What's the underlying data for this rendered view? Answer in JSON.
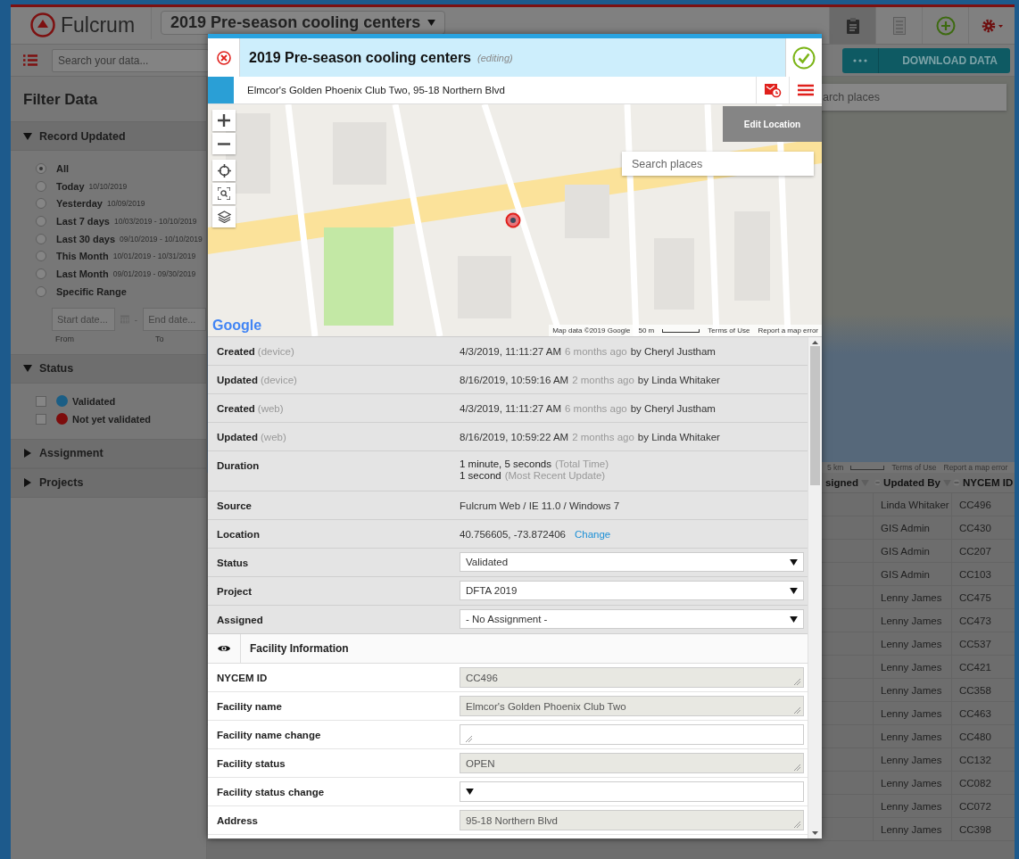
{
  "header": {
    "logo": "Fulcrum",
    "app_title": "2019 Pre-season cooling centers",
    "nav_tabs": [
      {
        "kind": "clipboard",
        "selected": true
      },
      {
        "kind": "list",
        "selected": false
      },
      {
        "kind": "add",
        "selected": false
      },
      {
        "kind": "settings",
        "selected": false
      }
    ]
  },
  "toolbar": {
    "search_placeholder": "Search your data...",
    "download_label": "DOWNLOAD DATA"
  },
  "sidebar": {
    "title": "Filter Data",
    "sections": [
      {
        "kind": "radios",
        "title": "Record Updated",
        "expanded": true,
        "options": [
          {
            "label": "All",
            "selected": true
          },
          {
            "label": "Today",
            "range": "10/10/2019",
            "selected": false
          },
          {
            "label": "Yesterday",
            "range": "10/09/2019",
            "selected": false
          },
          {
            "label": "Last 7 days",
            "range": "10/03/2019 - 10/10/2019",
            "selected": false
          },
          {
            "label": "Last 30 days",
            "range": "09/10/2019 - 10/10/2019",
            "selected": false
          },
          {
            "label": "This Month",
            "range": "10/01/2019 - 10/31/2019",
            "selected": false
          },
          {
            "label": "Last Month",
            "range": "09/01/2019 - 09/30/2019",
            "selected": false
          },
          {
            "label": "Specific Range",
            "selected": false
          }
        ],
        "date_range": {
          "start_placeholder": "Start date...",
          "separator": "-",
          "end_placeholder": "End date...",
          "start_caption": "From",
          "end_caption": "To"
        }
      },
      {
        "kind": "checks",
        "title": "Status",
        "expanded": true,
        "options": [
          {
            "label": "Validated",
            "checked": false,
            "color": "#1b5e85"
          },
          {
            "label": "Not yet validated",
            "checked": false,
            "color": "#7d0c0c"
          }
        ]
      },
      {
        "kind": "plain",
        "title": "Assignment",
        "expanded": false
      },
      {
        "kind": "plain",
        "title": "Projects",
        "expanded": false
      }
    ]
  },
  "background_map": {
    "search_placeholder": "arch places",
    "scale": "5 km",
    "terms": "Terms of Use",
    "report": "Report a map error"
  },
  "records_table": {
    "columns": [
      {
        "label": "signed"
      },
      {
        "label": "Updated By"
      },
      {
        "label": "NYCEM ID"
      }
    ],
    "rows": [
      {
        "updated_by": "Linda Whitaker",
        "nycem_id": "CC496"
      },
      {
        "updated_by": "GIS Admin",
        "nycem_id": "CC430"
      },
      {
        "updated_by": "GIS Admin",
        "nycem_id": "CC207"
      },
      {
        "updated_by": "GIS Admin",
        "nycem_id": "CC103"
      },
      {
        "updated_by": "Lenny James",
        "nycem_id": "CC475"
      },
      {
        "updated_by": "Lenny James",
        "nycem_id": "CC473"
      },
      {
        "updated_by": "Lenny James",
        "nycem_id": "CC537"
      },
      {
        "updated_by": "Lenny James",
        "nycem_id": "CC421"
      },
      {
        "updated_by": "Lenny James",
        "nycem_id": "CC358"
      },
      {
        "updated_by": "Lenny James",
        "nycem_id": "CC463"
      },
      {
        "updated_by": "Lenny James",
        "nycem_id": "CC480"
      },
      {
        "updated_by": "Lenny James",
        "nycem_id": "CC132"
      },
      {
        "updated_by": "Lenny James",
        "nycem_id": "CC082"
      },
      {
        "updated_by": "Lenny James",
        "nycem_id": "CC072"
      },
      {
        "updated_by": "Lenny James",
        "nycem_id": "CC398"
      }
    ]
  },
  "record_modal": {
    "title": "2019 Pre-season cooling centers",
    "mode": "(editing)",
    "subtitle": "Elmcor's Golden Phoenix Club Two, 95-18 Northern Blvd",
    "map": {
      "edit_button": "Edit Location",
      "search_placeholder": "Search places",
      "logo": "Google",
      "attribution": "Map data ©2019 Google",
      "scale": "50 m",
      "terms": "Terms of Use",
      "report": "Report a map error"
    },
    "info_rows": [
      {
        "kind": "text",
        "label": "Created",
        "qualifier": "(device)",
        "value": "4/3/2019, 11:11:27 AM",
        "ago": "6 months ago",
        "by": "by Cheryl Justham"
      },
      {
        "kind": "text",
        "label": "Updated",
        "qualifier": "(device)",
        "value": "8/16/2019, 10:59:16 AM",
        "ago": "2 months ago",
        "by": "by Linda Whitaker"
      },
      {
        "kind": "text",
        "label": "Created",
        "qualifier": "(web)",
        "value": "4/3/2019, 11:11:27 AM",
        "ago": "6 months ago",
        "by": "by Cheryl Justham"
      },
      {
        "kind": "text",
        "label": "Updated",
        "qualifier": "(web)",
        "value": "8/16/2019, 10:59:22 AM",
        "ago": "2 months ago",
        "by": "by Linda Whitaker"
      },
      {
        "kind": "duration",
        "label": "Duration",
        "lines": [
          {
            "value": "1 minute, 5 seconds",
            "note": "(Total Time)"
          },
          {
            "value": "1 second",
            "note": "(Most Recent Update)"
          }
        ]
      },
      {
        "kind": "text",
        "label": "Source",
        "value": "Fulcrum Web / IE 11.0 / Windows 7"
      },
      {
        "kind": "location",
        "label": "Location",
        "value": "40.756605, -73.872406",
        "link": "Change"
      },
      {
        "kind": "select",
        "label": "Status",
        "value": "Validated"
      },
      {
        "kind": "select",
        "label": "Project",
        "value": "DFTA 2019"
      },
      {
        "kind": "select",
        "label": "Assigned",
        "value": "- No Assignment -"
      }
    ],
    "section": {
      "title": "Facility Information"
    },
    "fields": [
      {
        "kind": "readonly",
        "label": "NYCEM ID",
        "value": "CC496"
      },
      {
        "kind": "readonly",
        "label": "Facility name",
        "value": "Elmcor's Golden Phoenix Club Two"
      },
      {
        "kind": "input",
        "label": "Facility name change"
      },
      {
        "kind": "readonly",
        "label": "Facility status",
        "value": "OPEN"
      },
      {
        "kind": "select",
        "label": "Facility status change"
      },
      {
        "kind": "readonly",
        "label": "Address",
        "value": "95-18 Northern Blvd"
      }
    ]
  }
}
